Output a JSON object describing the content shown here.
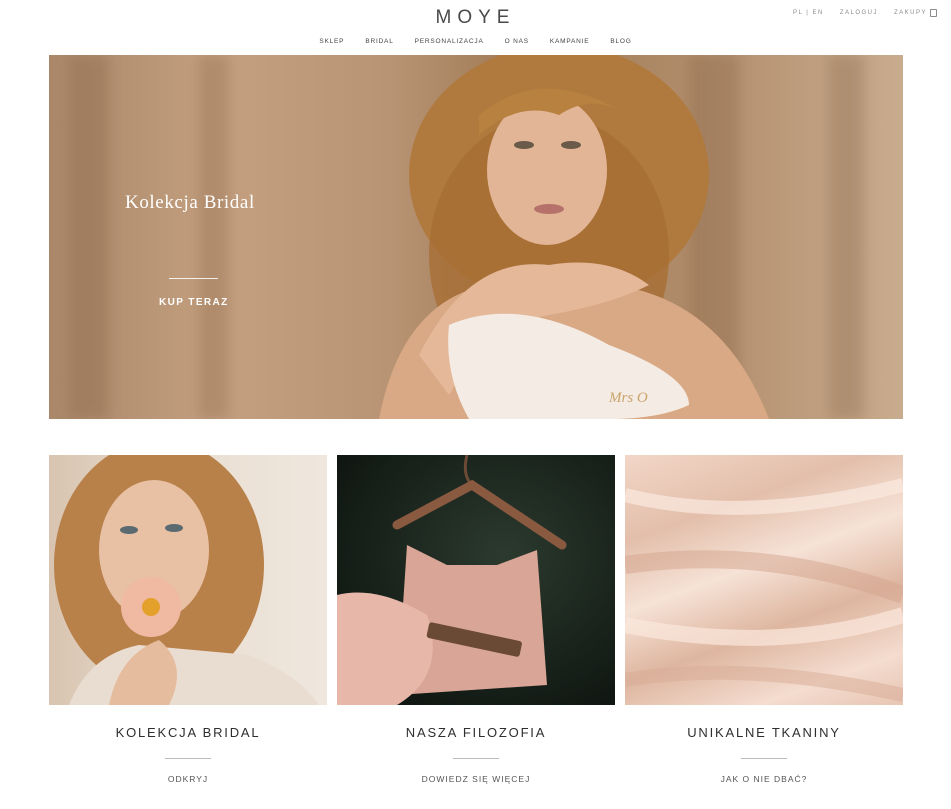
{
  "header": {
    "logo": "MOYE",
    "top_links": [
      {
        "label": "ZALOGUJ"
      },
      {
        "label": "ZAKUPY"
      }
    ],
    "lang": "PL | EN"
  },
  "nav": {
    "items": [
      "SKLEP",
      "BRIDAL",
      "PERSONALIZACJA",
      "O NAS",
      "KAMPANIE",
      "BLOG"
    ]
  },
  "hero": {
    "title": "Kolekcja Bridal",
    "cta": "KUP TERAZ",
    "mask_text": "Mrs O"
  },
  "cards": [
    {
      "title": "KOLEKCJA BRIDAL",
      "link": "ODKRYJ"
    },
    {
      "title": "NASZA FILOZOFIA",
      "link": "DOWIEDZ SIĘ WIĘCEJ"
    },
    {
      "title": "UNIKALNE TKANINY",
      "link": "JAK O NIE DBAĆ?"
    }
  ],
  "colors": {
    "text": "#3a3a3a",
    "hero_text": "#ffffff",
    "accent_line": "#bbbbbb"
  }
}
